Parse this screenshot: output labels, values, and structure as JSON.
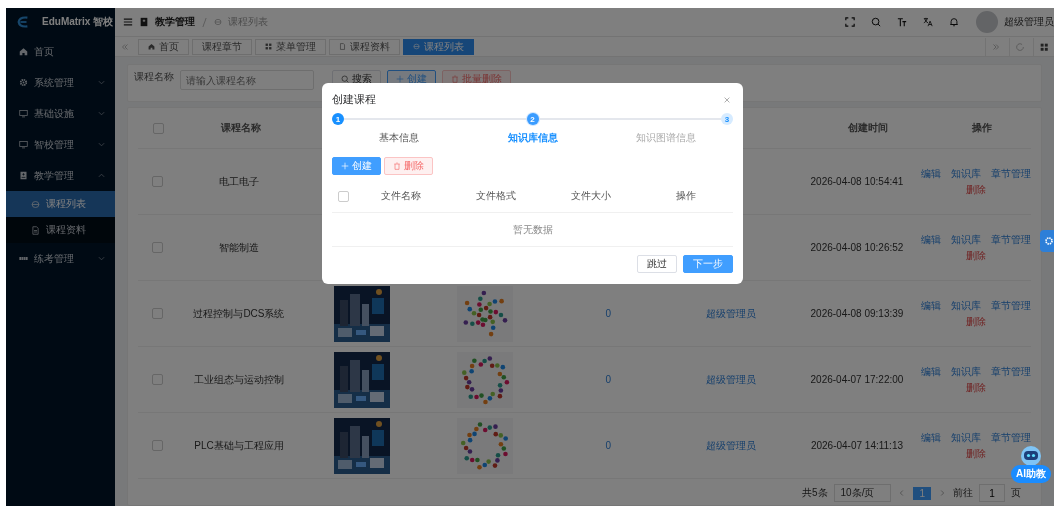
{
  "brand": {
    "name": "EduMatrix 智校"
  },
  "sidebar": {
    "items": [
      {
        "label": "首页",
        "kind": "link"
      },
      {
        "label": "系统管理",
        "kind": "group",
        "expanded": false
      },
      {
        "label": "基础设施",
        "kind": "group",
        "expanded": false
      },
      {
        "label": "智校管理",
        "kind": "group",
        "expanded": false
      },
      {
        "label": "教学管理",
        "kind": "group",
        "expanded": true,
        "children": [
          {
            "label": "课程列表",
            "selected": true
          },
          {
            "label": "课程资料",
            "selected": false
          }
        ]
      },
      {
        "label": "练考管理",
        "kind": "group",
        "expanded": false
      }
    ]
  },
  "header": {
    "breadcrumb": [
      "教学管理",
      "课程列表"
    ],
    "user": "超级管理员"
  },
  "tags": [
    {
      "label": "首页",
      "selected": false
    },
    {
      "label": "课程章节",
      "selected": false
    },
    {
      "label": "菜单管理",
      "selected": false
    },
    {
      "label": "课程资料",
      "selected": false
    },
    {
      "label": "课程列表",
      "selected": true
    }
  ],
  "search": {
    "label": "课程名称",
    "placeholder": "请输入课程名称",
    "buttons": [
      {
        "label": "搜索",
        "kind": "default"
      },
      {
        "label": "创建",
        "kind": "primary-plain"
      },
      {
        "label": "批量删除",
        "kind": "danger-disabled"
      }
    ]
  },
  "table": {
    "columns": [
      "课程名称",
      "创建时间",
      "操作"
    ],
    "select_all_checked": false,
    "rows": [
      {
        "checked": false,
        "name": "电工电子",
        "created": "2026-04-08 10:54:41",
        "actions": [
          {
            "label": "编辑",
            "kind": "link"
          },
          {
            "label": "知识库",
            "kind": "link"
          },
          {
            "label": "章节管理",
            "kind": "link"
          },
          {
            "label": "删除",
            "kind": "danger"
          }
        ]
      },
      {
        "checked": false,
        "name": "智能制造",
        "created": "2026-04-08 10:26:52",
        "actions": [
          {
            "label": "编辑",
            "kind": "link"
          },
          {
            "label": "知识库",
            "kind": "link"
          },
          {
            "label": "章节管理",
            "kind": "link"
          },
          {
            "label": "删除",
            "kind": "danger"
          }
        ]
      },
      {
        "checked": false,
        "name": "过程控制与DCS系统",
        "cover": {
          "kind": "picture"
        },
        "graph": {
          "kind": "picture"
        },
        "count": "0",
        "creator": "超级管理员",
        "created": "2026-04-08 09:13:39",
        "actions": [
          {
            "label": "编辑",
            "kind": "link"
          },
          {
            "label": "知识库",
            "kind": "link"
          },
          {
            "label": "章节管理",
            "kind": "link"
          },
          {
            "label": "删除",
            "kind": "danger"
          }
        ]
      },
      {
        "checked": false,
        "name": "工业组态与运动控制",
        "cover": {
          "kind": "picture"
        },
        "graph": {
          "kind": "picture"
        },
        "count": "0",
        "creator": "超级管理员",
        "created": "2026-04-07 17:22:00",
        "actions": [
          {
            "label": "编辑",
            "kind": "link"
          },
          {
            "label": "知识库",
            "kind": "link"
          },
          {
            "label": "章节管理",
            "kind": "link"
          },
          {
            "label": "删除",
            "kind": "danger"
          }
        ]
      },
      {
        "checked": false,
        "name": "PLC基础与工程应用",
        "cover": {
          "kind": "picture"
        },
        "graph": {
          "kind": "picture"
        },
        "count": "0",
        "creator": "超级管理员",
        "created": "2026-04-07 14:11:13",
        "actions": [
          {
            "label": "编辑",
            "kind": "link"
          },
          {
            "label": "知识库",
            "kind": "link"
          },
          {
            "label": "章节管理",
            "kind": "link"
          },
          {
            "label": "删除",
            "kind": "danger"
          }
        ]
      }
    ]
  },
  "pagination": {
    "total": "共5条",
    "page_size": "10条/页",
    "pages": [
      {
        "label": "1",
        "selected": true
      }
    ],
    "goto_label": "前往",
    "goto_value": "1",
    "goto_suffix": "页"
  },
  "assistant": {
    "label": "AI助教"
  },
  "dialog": {
    "title": "创建课程",
    "steps": [
      {
        "number": "1",
        "label": "基本信息",
        "completed": true,
        "selected": false
      },
      {
        "number": "2",
        "label": "知识库信息",
        "completed": false,
        "selected": true
      },
      {
        "number": "3",
        "label": "知识图谱信息",
        "completed": false,
        "selected": false
      }
    ],
    "select_all_checked": false,
    "buttons": [
      {
        "label": "创建",
        "kind": "primary"
      },
      {
        "label": "删除",
        "kind": "danger-disabled"
      }
    ],
    "columns": [
      "文件名称",
      "文件格式",
      "文件大小",
      "操作"
    ],
    "empty": "暂无数据",
    "footer": [
      {
        "label": "跳过",
        "kind": "default"
      },
      {
        "label": "下一步",
        "kind": "primary"
      }
    ]
  }
}
